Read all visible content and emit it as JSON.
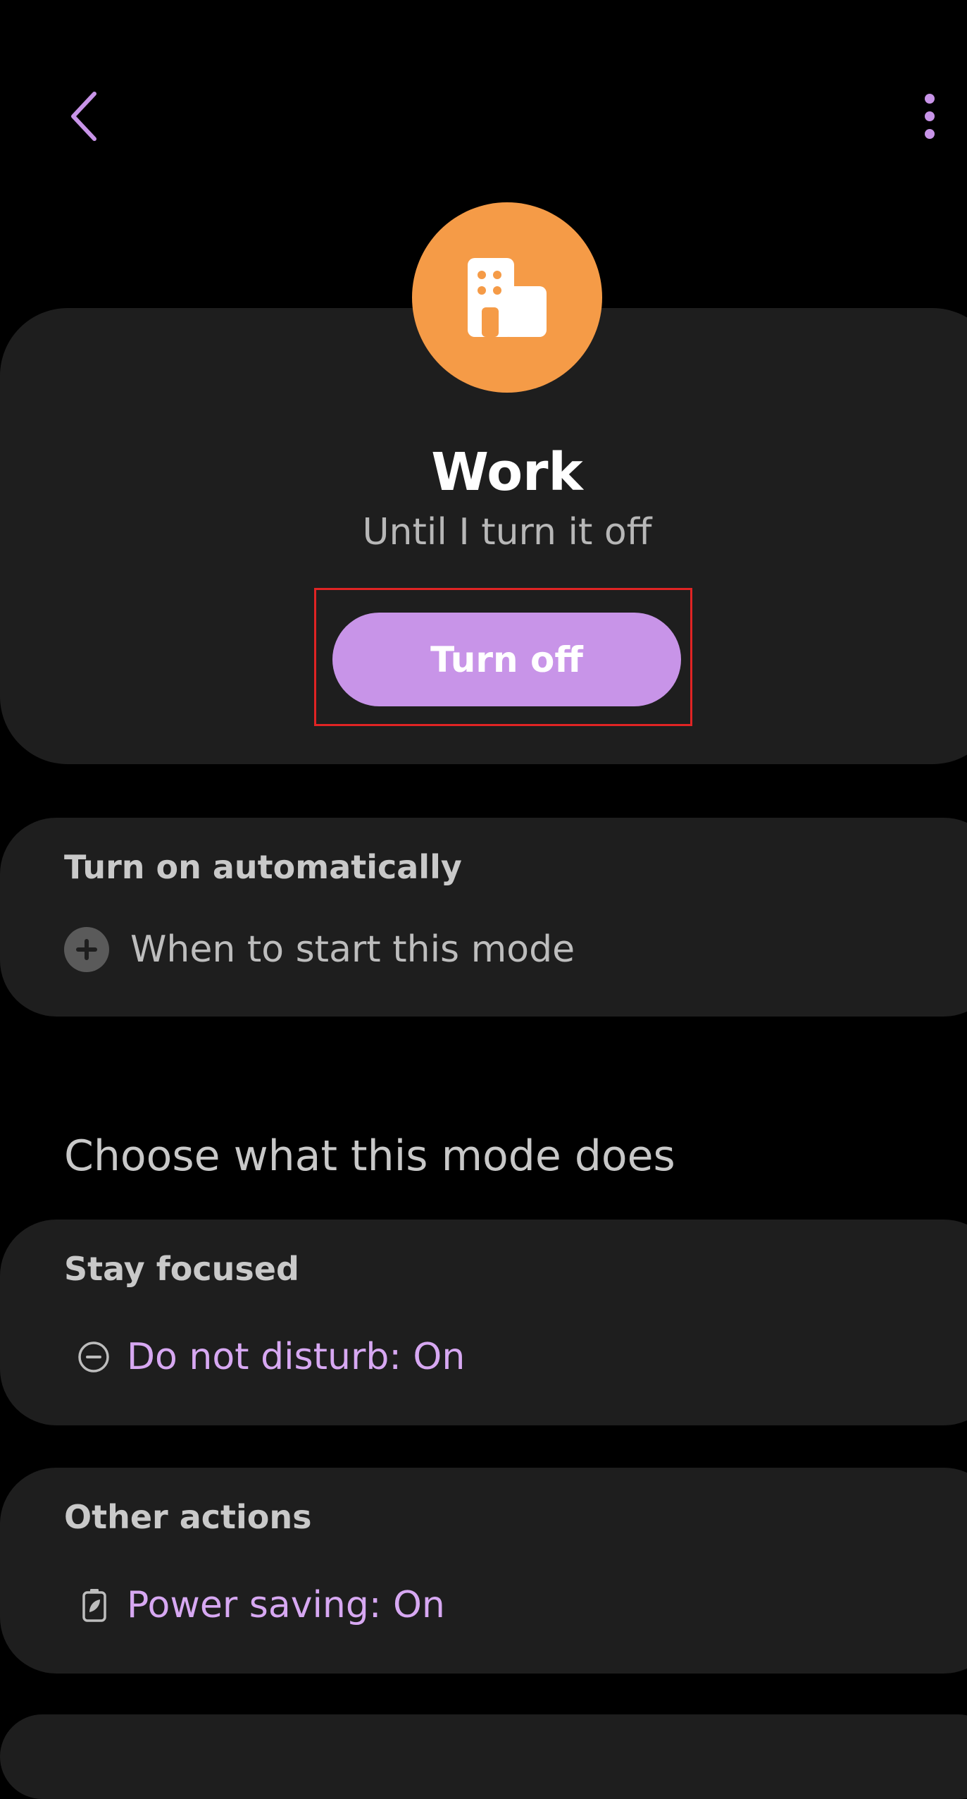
{
  "colors": {
    "background": "#000000",
    "card": "#1e1e1e",
    "accent": "#c894e8",
    "accent_text": "#d7a8f2",
    "mode_icon_bg": "#f59b47"
  },
  "top_bar": {
    "back_icon": "chevron-left-icon",
    "more_icon": "more-vertical-icon"
  },
  "mode": {
    "icon": "building-icon",
    "name": "Work",
    "status": "Until I turn it off",
    "turn_off_label": "Turn off"
  },
  "auto_start": {
    "title": "Turn on automatically",
    "add_icon": "add-circle-icon",
    "add_label": "When to start this mode"
  },
  "actions_section": {
    "heading": "Choose what this mode does"
  },
  "stay_focused": {
    "title": "Stay focused",
    "dnd_icon": "do-not-disturb-icon",
    "dnd_label": "Do not disturb: On"
  },
  "other_actions": {
    "title": "Other actions",
    "power_icon": "battery-saver-icon",
    "power_label": "Power saving: On"
  }
}
